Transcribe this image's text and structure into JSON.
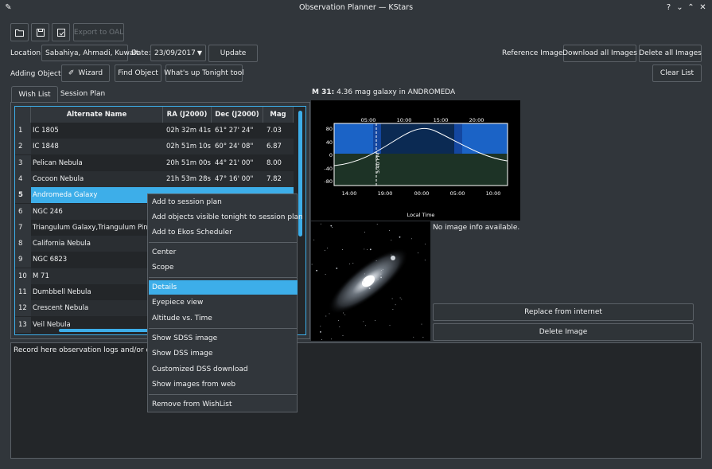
{
  "window": {
    "title": "Observation Planner — KStars",
    "help": "?",
    "minimize": "⌄",
    "maximize": "⌃",
    "close": "✕"
  },
  "toolbar": {
    "export_label": "Export to OAL"
  },
  "location": {
    "label": "Location:",
    "value": "Sabahiya, Ahmadi, Kuwait"
  },
  "date": {
    "label": "Date:",
    "value": "23/09/2017"
  },
  "update_label": "Update",
  "reference": {
    "label": "Reference Images:",
    "download": "Download all Images",
    "delete": "Delete all Images"
  },
  "adding": {
    "label": "Adding Objects:",
    "wizard": "Wizard",
    "find": "Find Object",
    "whats_up": "What's up Tonight tool"
  },
  "clear_list": "Clear List",
  "tabs": [
    {
      "label": "Wish List"
    },
    {
      "label": "Session Plan"
    }
  ],
  "table": {
    "headers": [
      "Alternate Name",
      "RA (J2000)",
      "Dec (J2000)",
      "Mag"
    ],
    "rows": [
      {
        "n": "1",
        "name": "IC 1805",
        "ra": "02h 32m 41s",
        "dec": "61° 27' 24\"",
        "mag": "7.03"
      },
      {
        "n": "2",
        "name": "IC 1848",
        "ra": "02h 51m 10s",
        "dec": "60° 24' 08\"",
        "mag": "6.87"
      },
      {
        "n": "3",
        "name": "Pelican Nebula",
        "ra": "20h 51m 00s",
        "dec": "44° 21' 00\"",
        "mag": "8.00"
      },
      {
        "n": "4",
        "name": "Cocoon Nebula",
        "ra": "21h 53m 28s",
        "dec": "47° 16' 00\"",
        "mag": "7.82"
      },
      {
        "n": "5",
        "name": "Andromeda Galaxy",
        "ra": "",
        "dec": "",
        "mag": ""
      },
      {
        "n": "6",
        "name": "NGC 246",
        "ra": "",
        "dec": "",
        "mag": ""
      },
      {
        "n": "7",
        "name": "Triangulum Galaxy,Triangulum Pinwh",
        "ra": "",
        "dec": "",
        "mag": ""
      },
      {
        "n": "8",
        "name": "California Nebula",
        "ra": "",
        "dec": "",
        "mag": ""
      },
      {
        "n": "9",
        "name": "NGC 6823",
        "ra": "",
        "dec": "",
        "mag": ""
      },
      {
        "n": "10",
        "name": "M 71",
        "ra": "",
        "dec": "",
        "mag": ""
      },
      {
        "n": "11",
        "name": "Dumbbell Nebula",
        "ra": "",
        "dec": "",
        "mag": ""
      },
      {
        "n": "12",
        "name": "Crescent Nebula",
        "ra": "",
        "dec": "",
        "mag": ""
      },
      {
        "n": "13",
        "name": "Veil Nebula",
        "ra": "",
        "dec": "",
        "mag": ""
      }
    ]
  },
  "object_info": {
    "name": "M 31:",
    "desc": "4.36 mag galaxy in ANDROMEDA"
  },
  "altitude_plot": {
    "top_ticks": [
      "05:00",
      "10:00",
      "15:00",
      "20:00"
    ],
    "bottom_ticks": [
      "14:00",
      "19:00",
      "00:00",
      "05:00",
      "10:00"
    ],
    "y_ticks": [
      "80",
      "40",
      "0",
      "-40",
      "-80"
    ],
    "now_label": "5:40 PM",
    "xlabel": "Local Time"
  },
  "image_info": "No image info available.",
  "replace_label": "Replace from internet",
  "delete_image_label": "Delete Image",
  "notes_placeholder": "Record here observation logs and/or data o",
  "menu": {
    "items": [
      "Add to session plan",
      "Add objects visible tonight to session plan",
      "Add to Ekos Scheduler",
      "Center",
      "Scope",
      "Details",
      "Eyepiece view",
      "Altitude vs. Time",
      "Show SDSS image",
      "Show DSS image",
      "Customized DSS download",
      "Show images from web",
      "Remove from WishList"
    ]
  },
  "colors": {
    "accent": "#3daee9",
    "background": "#31363b",
    "view": "#232629"
  }
}
